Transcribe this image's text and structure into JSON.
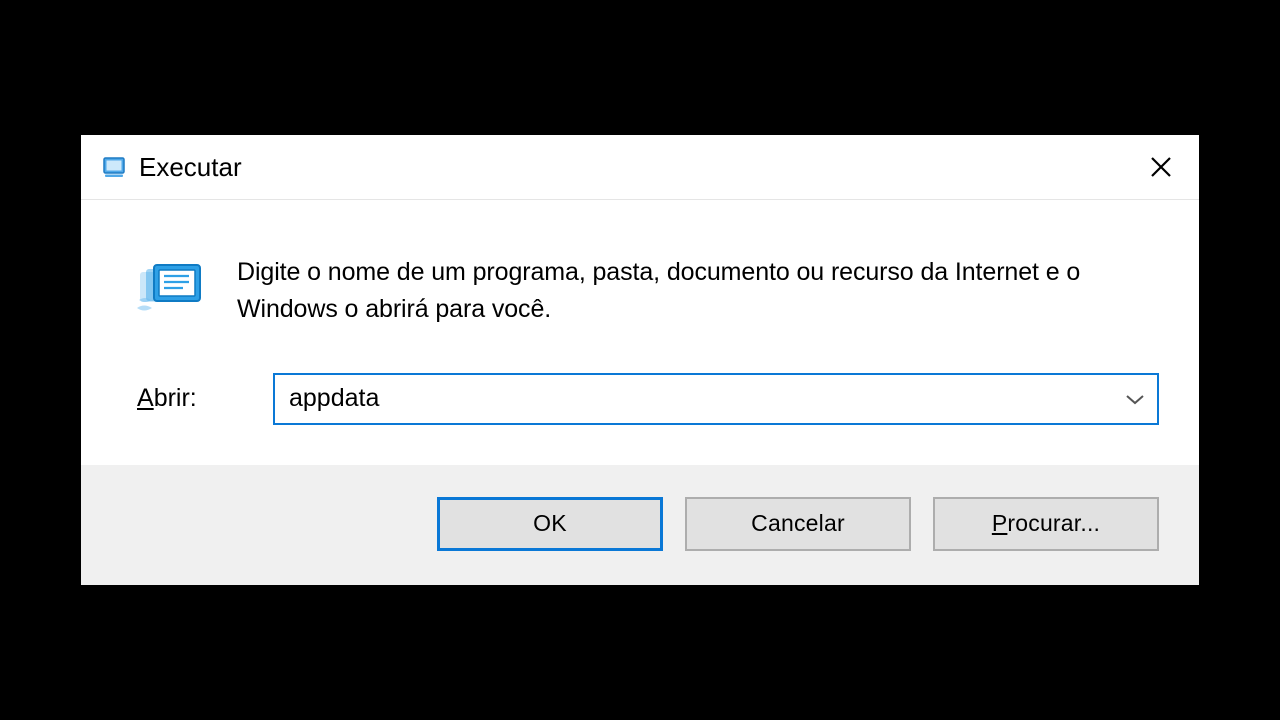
{
  "dialog": {
    "title": "Executar",
    "description": "Digite o nome de um programa, pasta, documento ou recurso da Internet e o Windows o abrirá para você.",
    "open_label_prefix": "A",
    "open_label_rest": "brir:",
    "input_value": "appdata",
    "buttons": {
      "ok": "OK",
      "cancel": "Cancelar",
      "browse_prefix": "P",
      "browse_rest": "rocurar..."
    }
  }
}
